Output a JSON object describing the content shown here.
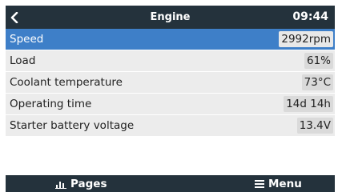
{
  "header": {
    "title": "Engine",
    "time": "09:44",
    "back_icon": "chevron-left-icon"
  },
  "rows": [
    {
      "label": "Speed",
      "value": "2992rpm",
      "selected": true
    },
    {
      "label": "Load",
      "value": "61%"
    },
    {
      "label": "Coolant temperature",
      "value": "73°C"
    },
    {
      "label": "Operating time",
      "value": "14d 14h"
    },
    {
      "label": "Starter battery voltage",
      "value": "13.4V"
    }
  ],
  "footer": {
    "pages_label": "Pages",
    "pages_icon": "bar-chart-icon",
    "menu_label": "Menu",
    "menu_icon": "hamburger-menu-icon"
  },
  "colors": {
    "header_bg": "#24323c",
    "selected_row": "#3e7fc8",
    "row_bg": "#ececec"
  }
}
